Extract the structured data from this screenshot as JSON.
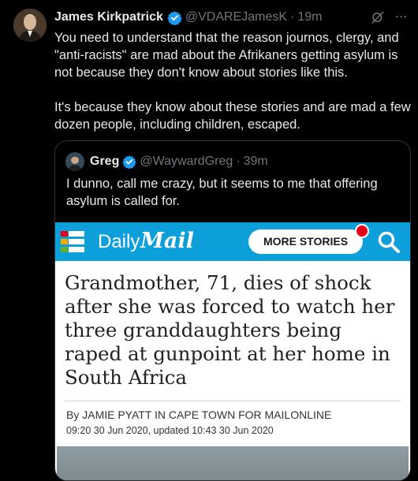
{
  "tweet": {
    "author_name": "James Kirkpatrick",
    "handle": "@VDAREJamesK",
    "separator": "·",
    "time": "19m",
    "paragraphs": [
      "You need to understand that the reason journos, clergy, and \"anti-racists\" are mad about the Afrikaners getting asylum is not because they don't know about stories like this.",
      "It's because they know about these stories and are mad a few dozen people, including children, escaped."
    ],
    "more_icon": "⋯"
  },
  "quote": {
    "author_name": "Greg",
    "handle": "@WaywardGreg",
    "separator": "·",
    "time": "39m",
    "text": "I dunno, call me crazy, but it seems to me that offering asylum is called for."
  },
  "article": {
    "brand_daily": "Daily",
    "brand_mail": "Mail",
    "more_stories": "MORE STORIES",
    "headline": "Grandmother, 71, dies of shock after she was forced to watch her three granddaughters being raped at gunpoint at her home in South Africa",
    "byline": "By JAMIE PYATT IN CAPE TOWN FOR MAILONLINE",
    "dateline": "09:20 30 Jun 2020, updated 10:43 30 Jun 2020"
  },
  "colors": {
    "background": "#000000",
    "text": "#e7e9ea",
    "muted": "#71767b",
    "verified": "#1d9bf0",
    "dailymail_blue": "#0d9fd9"
  }
}
